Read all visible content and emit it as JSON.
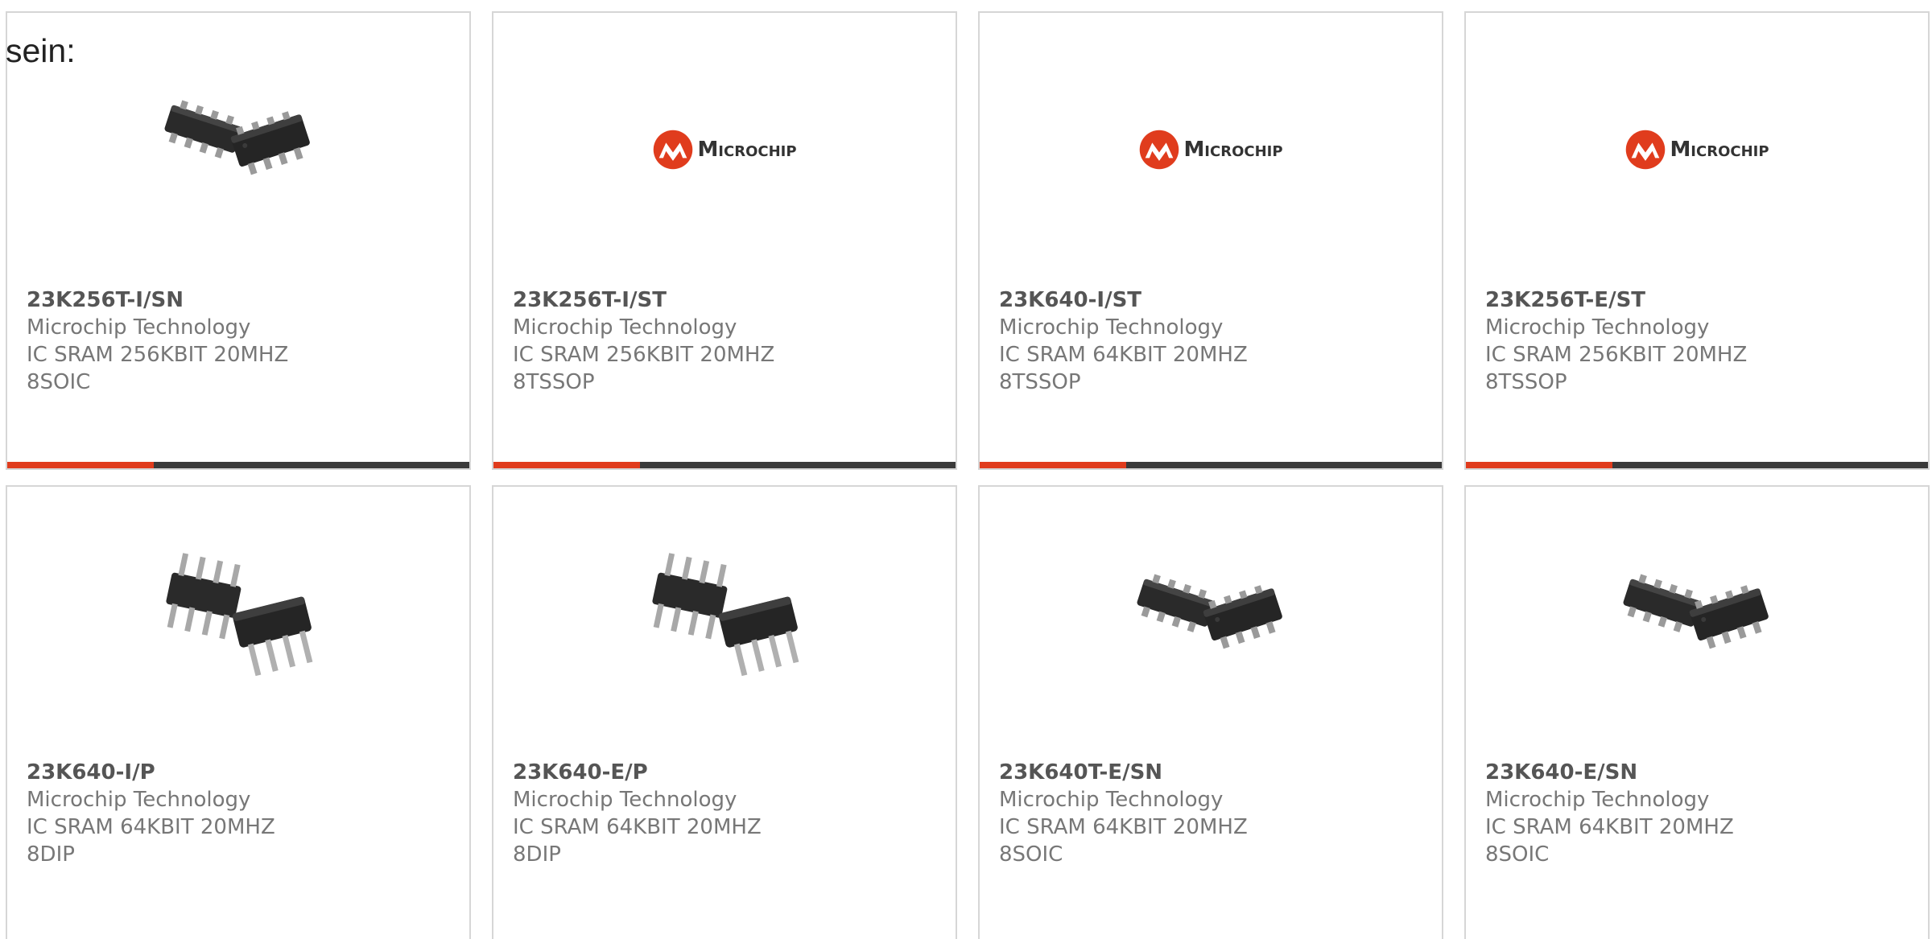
{
  "intro_text": "sein:",
  "colors": {
    "accent": "#e03c1d",
    "bar": "#3a3a3a",
    "card_border": "#d6d6d6",
    "text": "#777777",
    "part_number": "#555555"
  },
  "cards": [
    {
      "part": "23K256T-I/SN",
      "manufacturer": "Microchip Technology",
      "description": "IC SRAM 256KBIT 20MHZ 8SOIC",
      "image": "soic-chip-image"
    },
    {
      "part": "23K256T-I/ST",
      "manufacturer": "Microchip Technology",
      "description": "IC SRAM 256KBIT 20MHZ 8TSSOP",
      "image": "microchip-logo",
      "logo_text": "Microchip"
    },
    {
      "part": "23K640-I/ST",
      "manufacturer": "Microchip Technology",
      "description": "IC SRAM 64KBIT 20MHZ 8TSSOP",
      "image": "microchip-logo",
      "logo_text": "Microchip"
    },
    {
      "part": "23K256T-E/ST",
      "manufacturer": "Microchip Technology",
      "description": "IC SRAM 256KBIT 20MHZ 8TSSOP",
      "image": "microchip-logo",
      "logo_text": "Microchip"
    },
    {
      "part": "23K640-I/P",
      "manufacturer": "Microchip Technology",
      "description": "IC SRAM 64KBIT 20MHZ 8DIP",
      "image": "dip-chip-image"
    },
    {
      "part": "23K640-E/P",
      "manufacturer": "Microchip Technology",
      "description": "IC SRAM 64KBIT 20MHZ 8DIP",
      "image": "dip-chip-image"
    },
    {
      "part": "23K640T-E/SN",
      "manufacturer": "Microchip Technology",
      "description": "IC SRAM 64KBIT 20MHZ 8SOIC",
      "image": "soic-chip-image"
    },
    {
      "part": "23K640-E/SN",
      "manufacturer": "Microchip Technology",
      "description": "IC SRAM 64KBIT 20MHZ 8SOIC",
      "image": "soic-chip-image"
    }
  ]
}
